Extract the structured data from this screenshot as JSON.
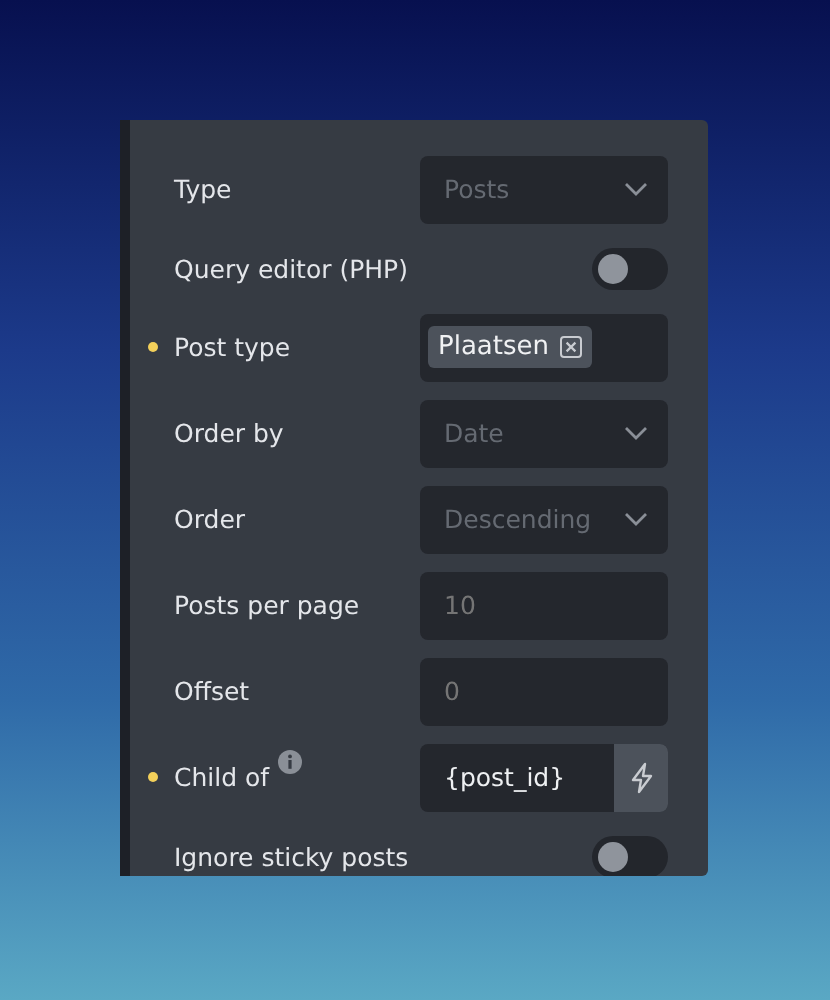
{
  "controls": [
    {
      "kind": "select",
      "label": "Type",
      "modified": false,
      "placeholder": "Posts"
    },
    {
      "kind": "toggle",
      "label": "Query editor (PHP)",
      "modified": false,
      "on": false
    },
    {
      "kind": "tags",
      "label": "Post type",
      "modified": true,
      "tags": [
        "Plaatsen"
      ]
    },
    {
      "kind": "select",
      "label": "Order by",
      "modified": false,
      "placeholder": "Date"
    },
    {
      "kind": "select",
      "label": "Order",
      "modified": false,
      "placeholder": "Descending"
    },
    {
      "kind": "input",
      "label": "Posts per page",
      "modified": false,
      "placeholder": "10"
    },
    {
      "kind": "input",
      "label": "Offset",
      "modified": false,
      "placeholder": "0"
    },
    {
      "kind": "dynamic",
      "label": "Child of",
      "modified": true,
      "info": true,
      "value": "{post_id}"
    },
    {
      "kind": "toggle",
      "label": "Ignore sticky posts",
      "modified": false,
      "on": false
    }
  ]
}
